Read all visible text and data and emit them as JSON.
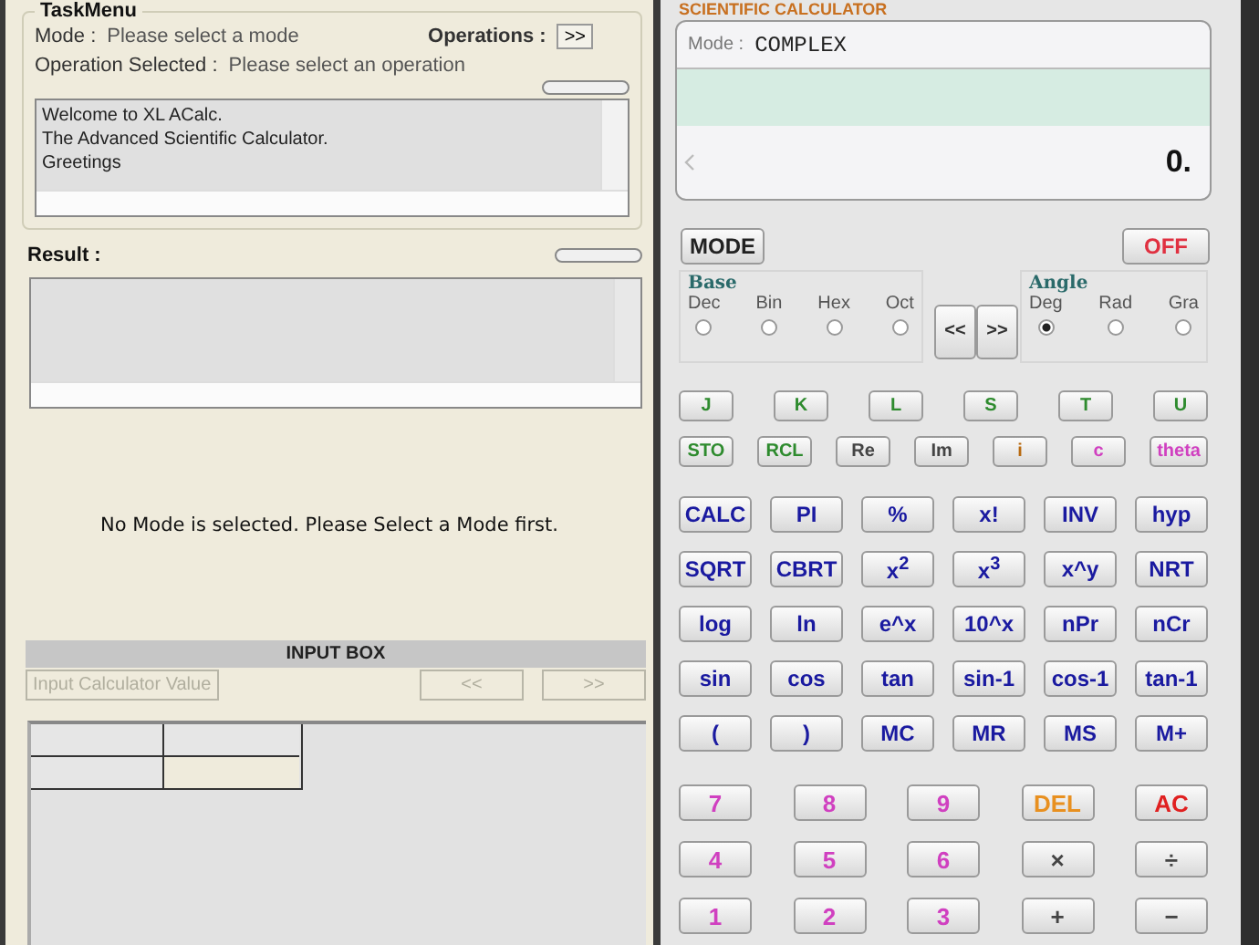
{
  "task_menu": {
    "title": "TaskMenu",
    "mode_label": "Mode :",
    "mode_value": "Please select a mode",
    "operations_label": "Operations :",
    "operations_button": ">>",
    "operation_label": "Operation Selected :",
    "operation_value": "Please select an operation",
    "log_lines": [
      "Welcome to XL ACalc.",
      "The Advanced Scientific Calculator.",
      "Greetings"
    ]
  },
  "result": {
    "label": "Result :"
  },
  "message": "No Mode is selected. Please Select a Mode first.",
  "input_box": {
    "title": "INPUT BOX",
    "buttons": [
      {
        "label": "Input Calculator Value",
        "disabled": true
      },
      {
        "label": "<<",
        "disabled": true
      },
      {
        "label": ">>",
        "disabled": true
      }
    ]
  },
  "calculator": {
    "title": "SCIENTIFIC CALCULATOR",
    "display": {
      "mode_label": "Mode :",
      "mode": "COMPLEX",
      "value": "0."
    },
    "mode_button": "MODE",
    "off_button": "OFF",
    "base": {
      "title": "Base",
      "options": [
        {
          "label": "Dec",
          "selected": false
        },
        {
          "label": "Bin",
          "selected": false
        },
        {
          "label": "Hex",
          "selected": false
        },
        {
          "label": "Oct",
          "selected": false
        }
      ]
    },
    "shift_buttons": [
      "<<",
      ">>"
    ],
    "angle": {
      "title": "Angle",
      "options": [
        {
          "label": "Deg",
          "selected": true
        },
        {
          "label": "Rad",
          "selected": false
        },
        {
          "label": "Gra",
          "selected": false
        }
      ]
    },
    "key_groups": [
      {
        "kind": "small",
        "rows": [
          {
            "keys": [
              {
                "label": "J",
                "color": "#2e8b2e"
              },
              {
                "label": "K",
                "color": "#2e8b2e"
              },
              {
                "label": "L",
                "color": "#2e8b2e"
              },
              {
                "label": "S",
                "color": "#2e8b2e"
              },
              {
                "label": "T",
                "color": "#2e8b2e"
              },
              {
                "label": "U",
                "color": "#2e8b2e"
              }
            ]
          },
          {
            "keys": [
              {
                "label": "STO",
                "color": "#2e8b2e"
              },
              {
                "label": "RCL",
                "color": "#2e8b2e"
              },
              {
                "label": "Re",
                "color": "#444444"
              },
              {
                "label": "Im",
                "color": "#444444"
              },
              {
                "label": "i",
                "color": "#b86a10"
              },
              {
                "label": "c",
                "color": "#d040c0"
              },
              {
                "label": "theta",
                "color": "#d040c0"
              }
            ]
          }
        ]
      },
      {
        "kind": "function",
        "rows": [
          {
            "keys": [
              {
                "label": "CALC",
                "color": "#1a1aa0"
              },
              {
                "label": "PI",
                "color": "#1a1aa0"
              },
              {
                "label": "%",
                "color": "#1a1aa0"
              },
              {
                "label": "x!",
                "color": "#1a1aa0"
              },
              {
                "label": "INV",
                "color": "#1a1aa0"
              },
              {
                "label": "hyp",
                "color": "#1a1aa0"
              }
            ]
          },
          {
            "keys": [
              {
                "label": "SQRT",
                "color": "#1a1aa0"
              },
              {
                "label": "CBRT",
                "color": "#1a1aa0"
              },
              {
                "label": "x$^{2}$",
                "color": "#1a1aa0"
              },
              {
                "label": "x$^{3}$",
                "color": "#1a1aa0"
              },
              {
                "label": "x^y",
                "color": "#1a1aa0"
              },
              {
                "label": "NRT",
                "color": "#1a1aa0"
              }
            ]
          },
          {
            "keys": [
              {
                "label": "log",
                "color": "#1a1aa0"
              },
              {
                "label": "ln",
                "color": "#1a1aa0"
              },
              {
                "label": "e^x",
                "color": "#1a1aa0"
              },
              {
                "label": "10^x",
                "color": "#1a1aa0"
              },
              {
                "label": "nPr",
                "color": "#1a1aa0"
              },
              {
                "label": "nCr",
                "color": "#1a1aa0"
              }
            ]
          },
          {
            "keys": [
              {
                "label": "sin",
                "color": "#1a1aa0"
              },
              {
                "label": "cos",
                "color": "#1a1aa0"
              },
              {
                "label": "tan",
                "color": "#1a1aa0"
              },
              {
                "label": "sin-1",
                "color": "#1a1aa0"
              },
              {
                "label": "cos-1",
                "color": "#1a1aa0"
              },
              {
                "label": "tan-1",
                "color": "#1a1aa0"
              }
            ]
          },
          {
            "keys": [
              {
                "label": "(",
                "color": "#1a1aa0"
              },
              {
                "label": ")",
                "color": "#1a1aa0"
              },
              {
                "label": "MC",
                "color": "#1a1aa0"
              },
              {
                "label": "MR",
                "color": "#1a1aa0"
              },
              {
                "label": "MS",
                "color": "#1a1aa0"
              },
              {
                "label": "M+",
                "color": "#1a1aa0"
              }
            ]
          }
        ]
      },
      {
        "kind": "digit",
        "rows": [
          {
            "keys": [
              {
                "label": "7",
                "color": "#d040c0"
              },
              {
                "label": "8",
                "color": "#d040c0"
              },
              {
                "label": "9",
                "color": "#d040c0"
              },
              {
                "label": "DEL",
                "color": "#e89020"
              },
              {
                "label": "AC",
                "color": "#e02020"
              }
            ]
          },
          {
            "keys": [
              {
                "label": "4",
                "color": "#d040c0"
              },
              {
                "label": "5",
                "color": "#d040c0"
              },
              {
                "label": "6",
                "color": "#d040c0"
              },
              {
                "label": "×",
                "color": "#444444"
              },
              {
                "label": "÷",
                "color": "#444444"
              }
            ]
          },
          {
            "keys": [
              {
                "label": "1",
                "color": "#d040c0"
              },
              {
                "label": "2",
                "color": "#d040c0"
              },
              {
                "label": "3",
                "color": "#d040c0"
              },
              {
                "label": "+",
                "color": "#444444"
              },
              {
                "label": "−",
                "color": "#444444"
              }
            ]
          }
        ]
      }
    ]
  }
}
